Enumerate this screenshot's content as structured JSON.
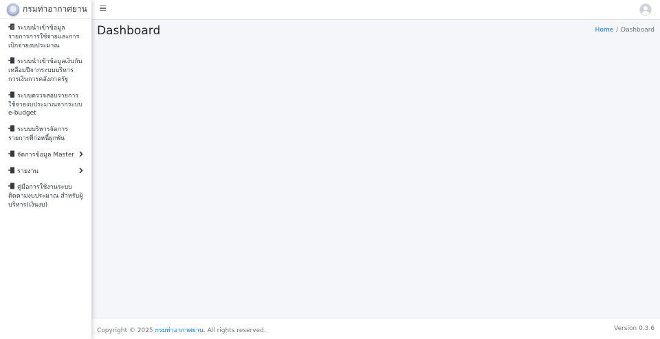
{
  "brand": {
    "name": "กรมท่าอากาศยาน"
  },
  "sidebar": {
    "items": [
      {
        "label": "ระบบนำเข้าข้อมูลรายการการใช้จ่ายและการเบิกจ่ายงบประมาณ",
        "icon": "sign-in-icon",
        "has_submenu": false
      },
      {
        "label": "ระบบนำเข้าข้อมูลเงินกันเหลื่อมปีจากระบบบริหารการเงินการคลังภาครัฐ",
        "icon": "sign-in-icon",
        "has_submenu": false
      },
      {
        "label": "ระบบตรวจสอบรายการใช้จ่ายงบประมาณจากระบบ e-budget",
        "icon": "sign-in-icon",
        "has_submenu": false
      },
      {
        "label": "ระบบบริหารจัดการรายการที่ก่อหนี้ผูกพัน",
        "icon": "sign-in-icon",
        "has_submenu": false
      },
      {
        "label": "จัดการข้อมูล Master",
        "icon": "sign-in-icon",
        "has_submenu": true
      },
      {
        "label": "รายงาน",
        "icon": "sign-in-icon",
        "has_submenu": true
      },
      {
        "label": "คู่มือการใช้งานระบบติดตามงบประมาณ สำหรับผู้บริหาร(เงินงบ)",
        "icon": "sign-in-icon",
        "has_submenu": false
      }
    ],
    "submenu_icon": "chevron-right-icon"
  },
  "topbar": {
    "menu_icon": "hamburger-icon",
    "user_icon": "user-avatar-icon"
  },
  "header": {
    "title": "Dashboard",
    "breadcrumb": {
      "home": "Home",
      "separator": "/",
      "current": "Dashboard"
    }
  },
  "footer": {
    "copyright_prefix": "Copyright © 2025",
    "org": "กรมท่าอากาศยาน",
    "rights": ". All rights reserved.",
    "version_label": "Version",
    "version": "0.3.6"
  },
  "colors": {
    "link": "#007bff",
    "background": "#f4f6f9",
    "sidebar": "#ffffff",
    "text": "#343a40"
  }
}
